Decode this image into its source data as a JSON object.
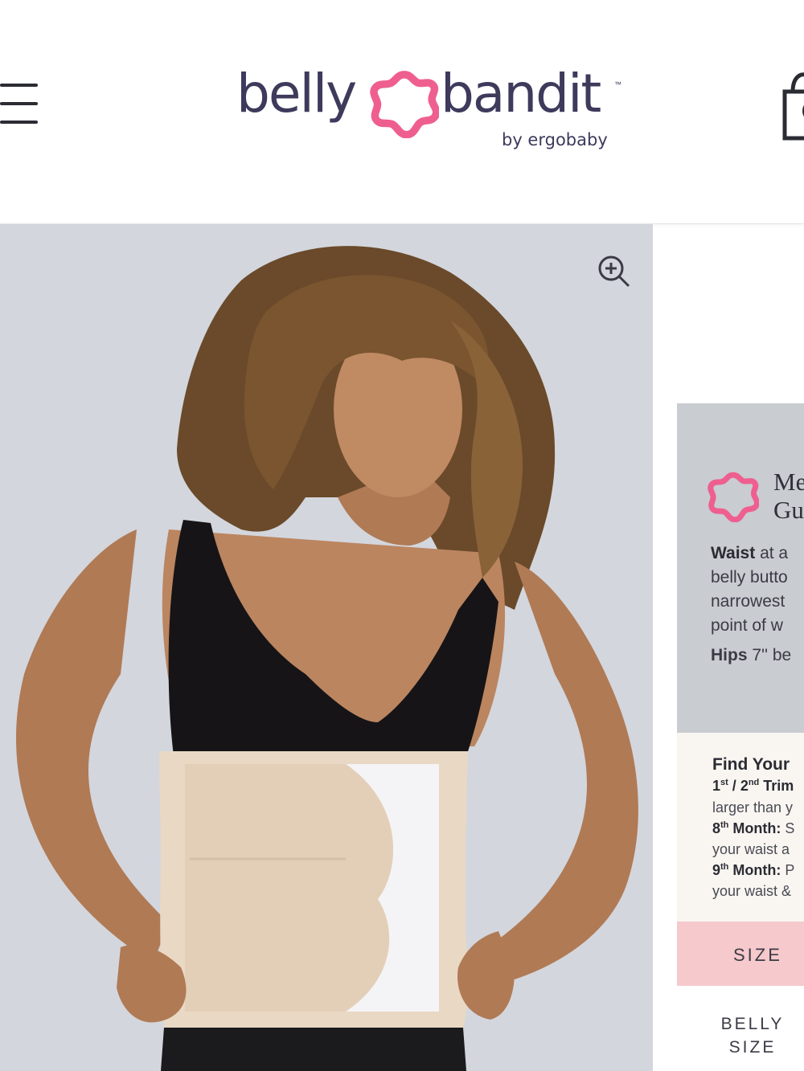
{
  "brand": {
    "name_part1": "belly",
    "name_part2": "bandit",
    "trademark": "™",
    "tagline": "by ergobaby",
    "text_color": "#3d3a5c",
    "flower_color": "#ee5f8f"
  },
  "header": {
    "menu_icon": "hamburger-icon",
    "cart_icon": "shopping-bag-icon"
  },
  "product_image": {
    "zoom_icon": "zoom-in-icon",
    "background_color": "#d3d6dd"
  },
  "size_guide": {
    "title_line1": "Me",
    "title_line2": "Gu",
    "waist_label": "Waist",
    "waist_text_1": " at a",
    "waist_text_2": "belly butto",
    "waist_text_3": "narrowest",
    "waist_text_4": "point of w",
    "hips_label": "Hips",
    "hips_text": " 7'' be",
    "find_title": "Find Your",
    "line1_label_a": "1",
    "line1_sup_a": "st",
    "line1_sep": " / ",
    "line1_label_b": "2",
    "line1_sup_b": "nd",
    "line1_label_c": " Trim",
    "line2": "larger than y",
    "line3_label": "8",
    "line3_sup": "th",
    "line3_label_b": " Month:",
    "line3_text": " S",
    "line4": "your waist a",
    "line5_label": "9",
    "line5_sup": "th",
    "line5_label_b": " Month:",
    "line5_text": " P",
    "line6": "your waist &",
    "size_header": "SIZE",
    "belly_size_header_1": "BELLY",
    "belly_size_header_2": "SIZE",
    "accent_band_color": "#f6c9cc"
  }
}
